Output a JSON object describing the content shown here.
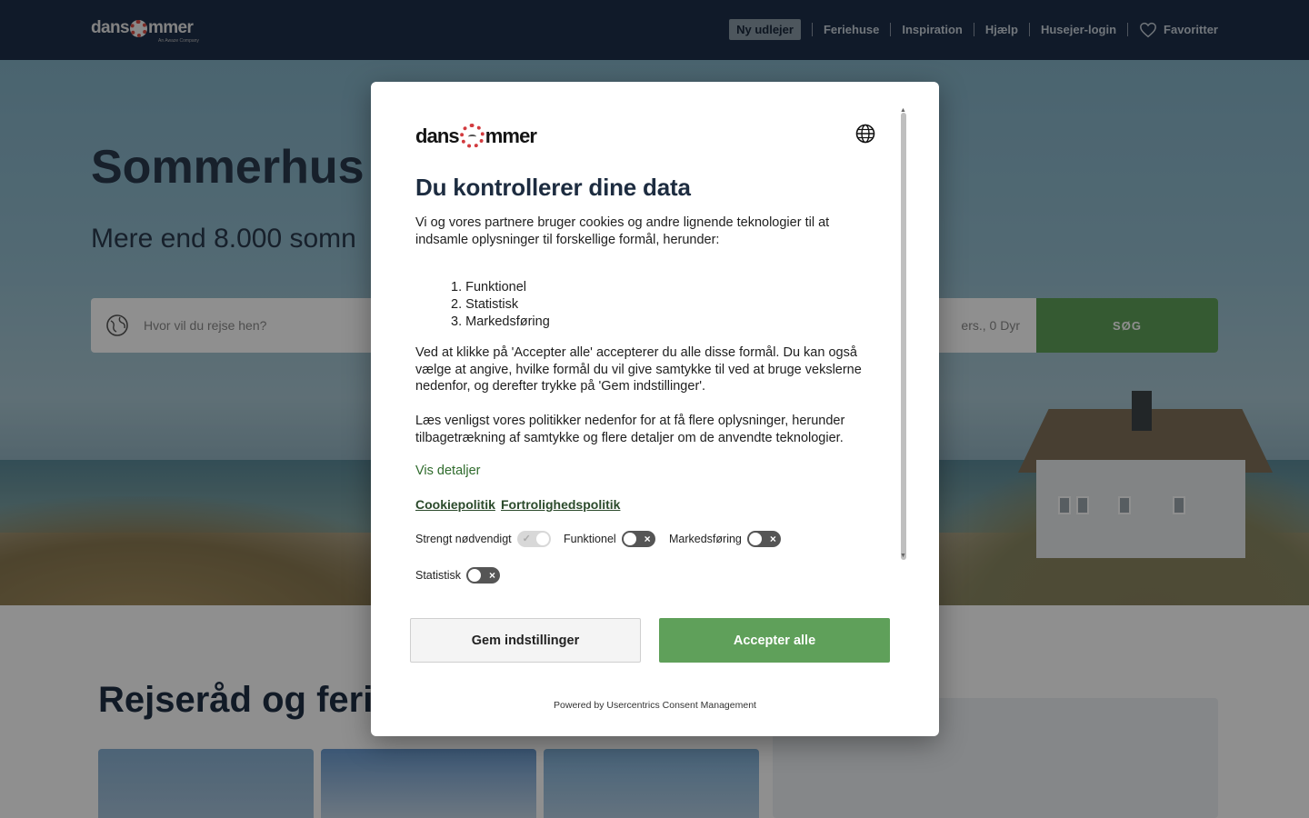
{
  "header": {
    "logo_text_left": "dans",
    "logo_text_right": "mmer",
    "logo_tagline": "An Awaze Company",
    "nav": {
      "new_landlord": "Ny udlejer",
      "holiday_homes": "Feriehuse",
      "inspiration": "Inspiration",
      "help": "Hjælp",
      "owner_login": "Husejer-login",
      "favorites": "Favoritter"
    }
  },
  "hero": {
    "title": "Sommerhus",
    "subtitle": "Mere end 8.000 somn",
    "search_placeholder": "Hvor vil du rejse hen?",
    "guests_text": "ers., 0 Dyr",
    "search_button": "SØG"
  },
  "below": {
    "section_title": "Rejseråd og ferie"
  },
  "consent": {
    "logo_left": "dans",
    "logo_right": "mmer",
    "title": "Du kontrollerer dine data",
    "intro": "Vi og vores partnere bruger cookies og andre lignende teknologier til at indsamle oplysninger til forskellige formål, herunder:",
    "purposes": [
      "1. Funktionel",
      "2. Statistisk",
      "3. Markedsføring"
    ],
    "accept_text": "Ved at klikke på 'Accepter alle' accepterer du alle disse formål. Du kan også vælge at angive, hvilke formål du vil give samtykke til ved at bruge vekslerne nedenfor, og derefter trykke på 'Gem indstillinger'.",
    "policy_text": "Læs venligst vores politikker nedenfor for at få flere oplysninger, herunder tilbagetrækning af samtykke og flere detaljer om de anvendte teknologier.",
    "show_details": "Vis detaljer",
    "cookie_policy": "Cookiepolitik",
    "privacy_policy": "Fortrolighedspolitik",
    "toggles": {
      "necessary": "Strengt nødvendigt",
      "functional": "Funktionel",
      "marketing": "Markedsføring",
      "statistics": "Statistisk"
    },
    "toggle_states": {
      "necessary": true,
      "functional": false,
      "marketing": false,
      "statistics": false
    },
    "save_button": "Gem indstillinger",
    "accept_button": "Accepter alle",
    "powered_by": "Powered by Usercentrics Consent Management"
  },
  "colors": {
    "header_bg": "#1d2f4a",
    "accent_green": "#5fa05a",
    "link_green": "#2f6b2c"
  },
  "icons": [
    "globe-icon",
    "heart-icon",
    "language-icon",
    "check-icon",
    "close-icon",
    "scroll-arrow-up-icon",
    "scroll-arrow-down-icon"
  ]
}
